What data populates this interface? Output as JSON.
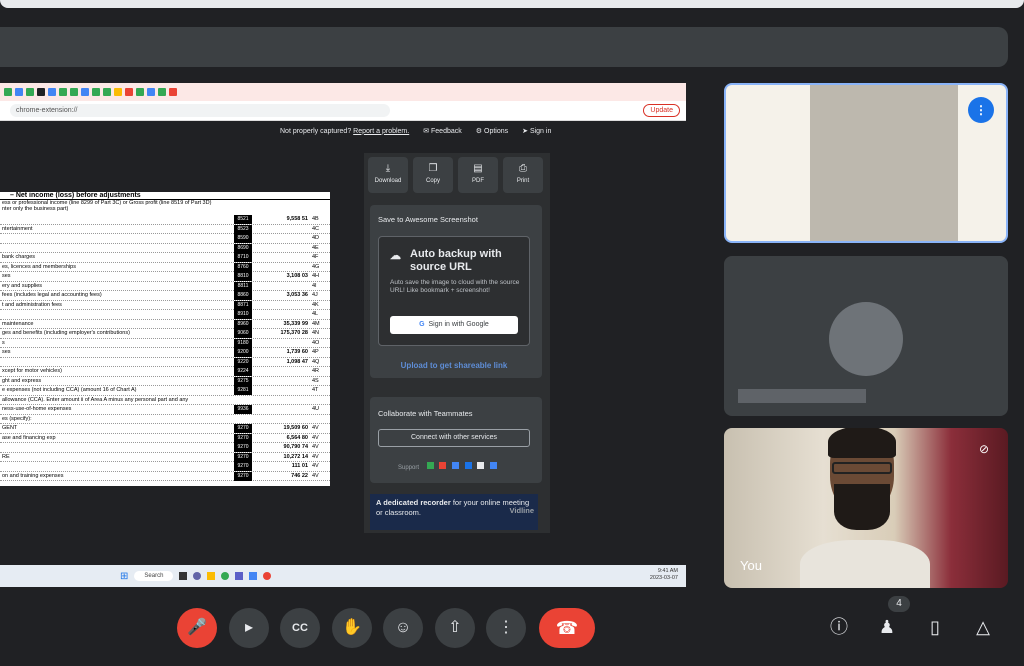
{
  "browser": {
    "url": "chrome-extension://",
    "update_label": "Update"
  },
  "extension": {
    "notice": "Not properly captured?",
    "report": "Report a problem.",
    "feedback": "Feedback",
    "options": "Options",
    "signin": "Sign in",
    "actions": [
      "Download",
      "Copy",
      "PDF",
      "Print"
    ],
    "save_title": "Save to Awesome Screenshot",
    "backup_title": "Auto backup with source URL",
    "backup_desc": "Auto save the image to cloud with the source URL! Like bookmark + screenshot!",
    "google_btn": "Sign in with Google",
    "upload_btn": "Upload to get shareable link",
    "collab_title": "Collaborate with Teammates",
    "connect_btn": "Connect with other services",
    "support_label": "Support",
    "recorder_text_bold": "A dedicated recorder",
    "recorder_text": " for your online meeting or classroom.",
    "recorder_brand": "Vidline"
  },
  "document": {
    "heading": "– Net income (loss) before adjustments",
    "subheading": "ess or professional income (line 8299 of Part 3C) or Gross profit (line 8519 of Part 3D)",
    "subheading2": "nter only the business part)",
    "rows": [
      {
        "label": "",
        "code": "8521",
        "amount": "9,558 51",
        "line": "4B"
      },
      {
        "label": "ntertainment",
        "code": "8523",
        "amount": "",
        "line": "4C"
      },
      {
        "label": "",
        "code": "8590",
        "amount": "",
        "line": "4D"
      },
      {
        "label": "",
        "code": "8690",
        "amount": "",
        "line": "4E"
      },
      {
        "label": "bank charges",
        "code": "8710",
        "amount": "",
        "line": "4F"
      },
      {
        "label": "es, licences and memberships",
        "code": "8760",
        "amount": "",
        "line": "4G"
      },
      {
        "label": "ses",
        "code": "8810",
        "amount": "3,108 03",
        "line": "4H"
      },
      {
        "label": "ery and supplies",
        "code": "8811",
        "amount": "",
        "line": "4I"
      },
      {
        "label": "fees (includes legal and accounting fees)",
        "code": "8860",
        "amount": "3,053 36",
        "line": "4J"
      },
      {
        "label": "t and administration fees",
        "code": "8871",
        "amount": "",
        "line": "4K"
      },
      {
        "label": "",
        "code": "8910",
        "amount": "",
        "line": "4L"
      },
      {
        "label": "maintenance",
        "code": "8960",
        "amount": "35,339 99",
        "line": "4M"
      },
      {
        "label": "ges and benefits (including employer's contributions)",
        "code": "9060",
        "amount": "175,370 28",
        "line": "4N"
      },
      {
        "label": "s",
        "code": "9180",
        "amount": "",
        "line": "4O"
      },
      {
        "label": "ses",
        "code": "9200",
        "amount": "1,739 60",
        "line": "4P"
      },
      {
        "label": "",
        "code": "9220",
        "amount": "1,098 47",
        "line": "4Q"
      },
      {
        "label": "xcept for motor vehicles)",
        "code": "9224",
        "amount": "",
        "line": "4R"
      },
      {
        "label": "ght and express",
        "code": "9275",
        "amount": "",
        "line": "4S"
      },
      {
        "label": "e expenses (not including CCA) (amount 16 of Chart A)",
        "code": "9281",
        "amount": "",
        "line": "4T"
      },
      {
        "label": "allowance (CCA). Enter amount ii of Area A minus any personal part and any",
        "code": "",
        "amount": "",
        "line": ""
      },
      {
        "label": "ness-use-of-home expenses",
        "code": "9936",
        "amount": "",
        "line": "4U"
      },
      {
        "label": "es (specify):",
        "code": "",
        "amount": "",
        "line": ""
      },
      {
        "label": "GENT",
        "code": "9270",
        "amount": "19,509 60",
        "line": "4V"
      },
      {
        "label": "ase and financing exp",
        "code": "9270",
        "amount": "6,564 80",
        "line": "4V"
      },
      {
        "label": "",
        "code": "9270",
        "amount": "90,790 74",
        "line": "4V"
      },
      {
        "label": "RE",
        "code": "9270",
        "amount": "10,272 14",
        "line": "4V"
      },
      {
        "label": "",
        "code": "9270",
        "amount": "111 01",
        "line": "4V"
      },
      {
        "label": "on and training expenses",
        "code": "9270",
        "amount": "746 22",
        "line": "4V"
      }
    ]
  },
  "taskbar": {
    "search": "Search",
    "time": "9:41 AM",
    "date": "2023-03-07"
  },
  "meet": {
    "self_name": "You",
    "participants_count": "4"
  }
}
